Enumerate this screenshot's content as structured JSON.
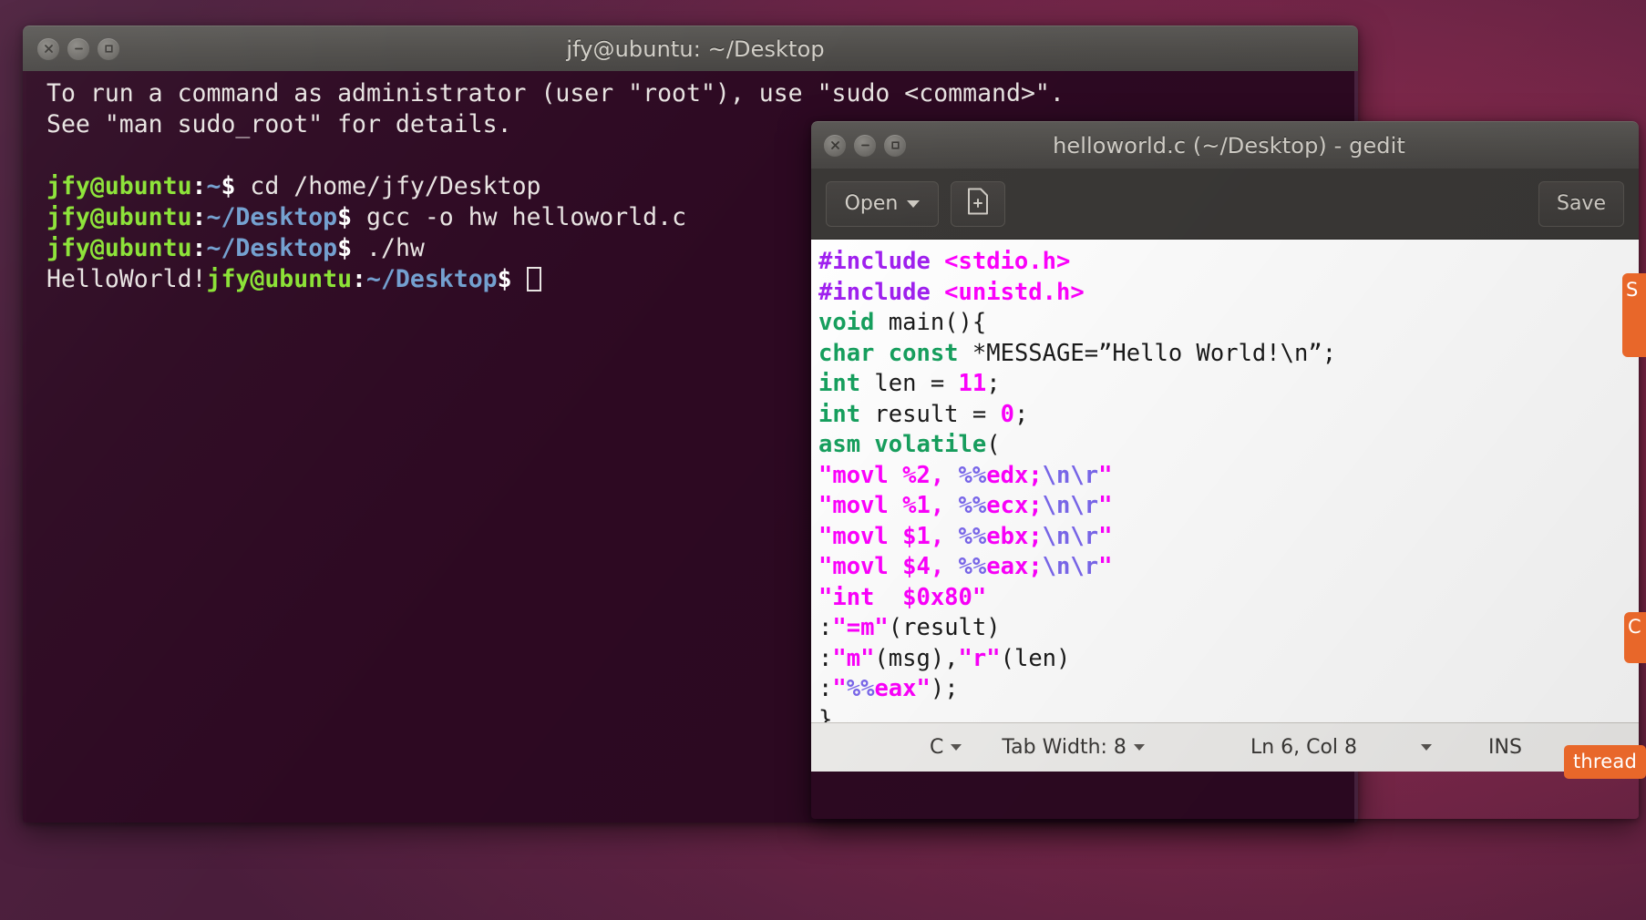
{
  "terminal": {
    "title": "jfy@ubuntu: ~/Desktop",
    "buttons": {
      "close": "close-icon",
      "minimize": "minimize-icon",
      "maximize": "maximize-icon"
    },
    "lines": [
      {
        "segments": [
          {
            "text": "To run a command as administrator (user \"root\"), use \"sudo <command>\".",
            "style": "plain"
          }
        ]
      },
      {
        "segments": [
          {
            "text": "See \"man sudo_root\" for details.",
            "style": "plain"
          }
        ]
      },
      {
        "segments": [
          {
            "text": "",
            "style": "plain"
          }
        ]
      },
      {
        "segments": [
          {
            "text": "jfy@ubuntu",
            "style": "user"
          },
          {
            "text": ":",
            "style": "colon"
          },
          {
            "text": "~",
            "style": "path"
          },
          {
            "text": "$ ",
            "style": "dollar"
          },
          {
            "text": "cd /home/jfy/Desktop",
            "style": "plain"
          }
        ]
      },
      {
        "segments": [
          {
            "text": "jfy@ubuntu",
            "style": "user"
          },
          {
            "text": ":",
            "style": "colon"
          },
          {
            "text": "~/Desktop",
            "style": "path"
          },
          {
            "text": "$ ",
            "style": "dollar"
          },
          {
            "text": "gcc -o hw helloworld.c",
            "style": "plain"
          }
        ]
      },
      {
        "segments": [
          {
            "text": "jfy@ubuntu",
            "style": "user"
          },
          {
            "text": ":",
            "style": "colon"
          },
          {
            "text": "~/Desktop",
            "style": "path"
          },
          {
            "text": "$ ",
            "style": "dollar"
          },
          {
            "text": "./hw",
            "style": "plain"
          }
        ]
      },
      {
        "segments": [
          {
            "text": "HelloWorld!",
            "style": "plain"
          },
          {
            "text": "jfy@ubuntu",
            "style": "user"
          },
          {
            "text": ":",
            "style": "colon"
          },
          {
            "text": "~/Desktop",
            "style": "path"
          },
          {
            "text": "$ ",
            "style": "dollar"
          },
          {
            "text": "",
            "style": "cursor"
          }
        ]
      }
    ]
  },
  "gedit": {
    "title": "helloworld.c (~/Desktop) - gedit",
    "toolbar": {
      "open_label": "Open",
      "new_document_icon": "new-document-icon",
      "save_label": "Save"
    },
    "code_lines": [
      [
        {
          "t": "#include ",
          "c": "pre"
        },
        {
          "t": "<stdio.h>",
          "c": "inc"
        }
      ],
      [
        {
          "t": "#include ",
          "c": "pre"
        },
        {
          "t": "<unistd.h>",
          "c": "inc"
        }
      ],
      [
        {
          "t": "void",
          "c": "kw"
        },
        {
          "t": " main(){",
          "c": "txt"
        }
      ],
      [
        {
          "t": "char const",
          "c": "kw"
        },
        {
          "t": " *MESSAGE=”Hello World!\\n”;",
          "c": "txt"
        }
      ],
      [
        {
          "t": "int",
          "c": "kw"
        },
        {
          "t": " len = ",
          "c": "txt"
        },
        {
          "t": "11",
          "c": "num"
        },
        {
          "t": ";",
          "c": "txt"
        }
      ],
      [
        {
          "t": "int",
          "c": "kw"
        },
        {
          "t": " result = ",
          "c": "txt"
        },
        {
          "t": "0",
          "c": "num"
        },
        {
          "t": ";",
          "c": "txt"
        }
      ],
      [
        {
          "t": "asm volatile",
          "c": "kw"
        },
        {
          "t": "(",
          "c": "txt"
        }
      ],
      [
        {
          "t": "\"movl %2, ",
          "c": "str"
        },
        {
          "t": "%%",
          "c": "esc"
        },
        {
          "t": "edx;",
          "c": "str"
        },
        {
          "t": "\\n\\r",
          "c": "esc"
        },
        {
          "t": "\"",
          "c": "str"
        }
      ],
      [
        {
          "t": "\"movl %1, ",
          "c": "str"
        },
        {
          "t": "%%",
          "c": "esc"
        },
        {
          "t": "ecx;",
          "c": "str"
        },
        {
          "t": "\\n\\r",
          "c": "esc"
        },
        {
          "t": "\"",
          "c": "str"
        }
      ],
      [
        {
          "t": "\"movl $1, ",
          "c": "str"
        },
        {
          "t": "%%",
          "c": "esc"
        },
        {
          "t": "ebx;",
          "c": "str"
        },
        {
          "t": "\\n\\r",
          "c": "esc"
        },
        {
          "t": "\"",
          "c": "str"
        }
      ],
      [
        {
          "t": "\"movl $4, ",
          "c": "str"
        },
        {
          "t": "%%",
          "c": "esc"
        },
        {
          "t": "eax;",
          "c": "str"
        },
        {
          "t": "\\n\\r",
          "c": "esc"
        },
        {
          "t": "\"",
          "c": "str"
        }
      ],
      [
        {
          "t": "\"int  $0x80\"",
          "c": "str"
        }
      ],
      [
        {
          "t": ":",
          "c": "txt"
        },
        {
          "t": "\"=m\"",
          "c": "str"
        },
        {
          "t": "(result)",
          "c": "txt"
        }
      ],
      [
        {
          "t": ":",
          "c": "txt"
        },
        {
          "t": "\"m\"",
          "c": "str"
        },
        {
          "t": "(msg),",
          "c": "txt"
        },
        {
          "t": "\"r\"",
          "c": "str"
        },
        {
          "t": "(len)",
          "c": "txt"
        }
      ],
      [
        {
          "t": ":",
          "c": "txt"
        },
        {
          "t": "\"",
          "c": "str"
        },
        {
          "t": "%%",
          "c": "esc"
        },
        {
          "t": "eax\"",
          "c": "str"
        },
        {
          "t": ");",
          "c": "txt"
        }
      ],
      [
        {
          "t": "}",
          "c": "txt"
        }
      ]
    ],
    "statusbar": {
      "language": "C",
      "tab_width": "Tab Width: 8",
      "position": "Ln 6, Col 8",
      "insert_mode": "INS"
    }
  },
  "desktop": {
    "thread_widget_label": "thread",
    "edge_widget_top_label": "S",
    "edge_widget_mid_label": "C"
  }
}
